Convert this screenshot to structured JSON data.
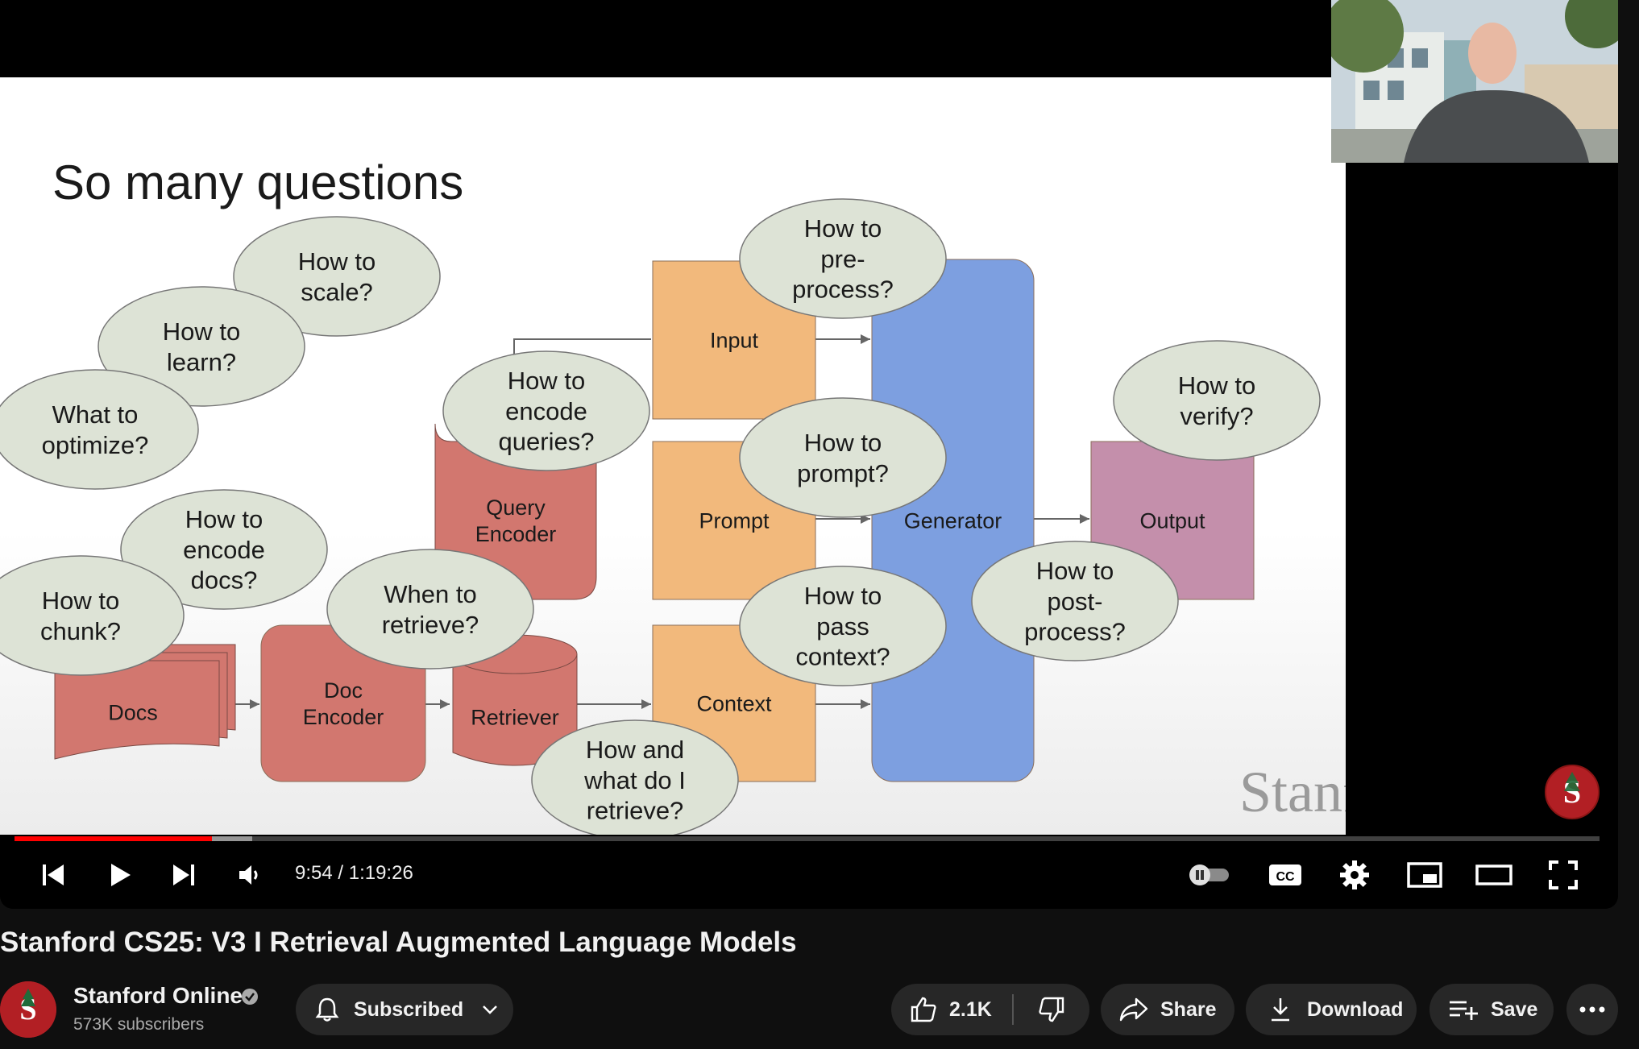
{
  "slide": {
    "title": "So many questions",
    "boxes": {
      "docs": "Docs",
      "doc_encoder": [
        "Doc",
        "Encoder"
      ],
      "retriever": "Retriever",
      "query_encoder": [
        "Query",
        "Encoder"
      ],
      "input": "Input",
      "prompt": "Prompt",
      "context": "Context",
      "generator": "Generator",
      "output": "Output"
    },
    "questions": {
      "scale": [
        "How to",
        "scale?"
      ],
      "learn": [
        "How to",
        "learn?"
      ],
      "optimize": [
        "What to",
        "optimize?"
      ],
      "encode_docs": [
        "How to",
        "encode",
        "docs?"
      ],
      "chunk": [
        "How to",
        "chunk?"
      ],
      "when_retrieve": [
        "When to",
        "retrieve?"
      ],
      "encode_queries": [
        "How to",
        "encode",
        "queries?"
      ],
      "preprocess": [
        "How to",
        "pre-",
        "process?"
      ],
      "prompt": [
        "How to",
        "prompt?"
      ],
      "pass_context": [
        "How to",
        "pass",
        "context?"
      ],
      "what_retrieve": [
        "How and",
        "what do I",
        "retrieve?"
      ],
      "verify": [
        "How to",
        "verify?"
      ],
      "postprocess": [
        "How to",
        "post-",
        "process?"
      ]
    },
    "watermark": "Stanford"
  },
  "player": {
    "time_display": "9:54 / 1:19:26",
    "progress_fraction": 0.1246,
    "buffered_fraction": 0.15
  },
  "video": {
    "title": "Stanford CS25: V3 I Retrieval Augmented Language Models"
  },
  "channel": {
    "name": "Stanford Online",
    "subscribers": "573K subscribers"
  },
  "actions": {
    "subscribed_label": "Subscribed",
    "like_count": "2.1K",
    "share_label": "Share",
    "download_label": "Download",
    "save_label": "Save"
  },
  "colors": {
    "box_red": "#d2776f",
    "box_orange": "#f2b97c",
    "box_blue": "#7d9fe0",
    "box_purple": "#c48fab",
    "bubble": "#dde3d6",
    "progress_red": "#ff0000"
  }
}
